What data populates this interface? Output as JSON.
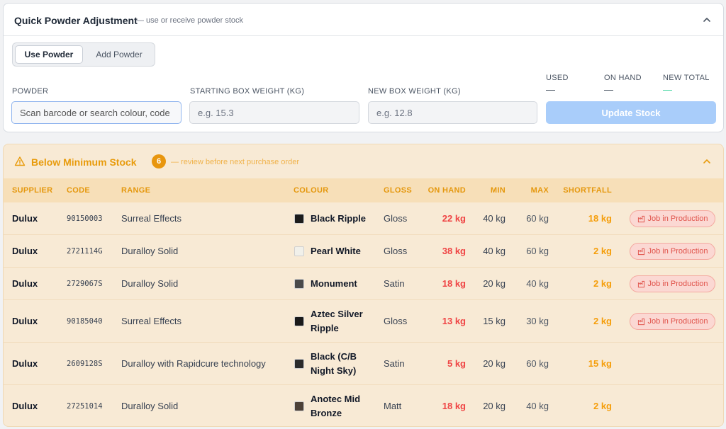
{
  "quick_adjust": {
    "title": "Quick Powder Adjustment",
    "subtitle": "— use or receive powder stock",
    "mode_tabs": [
      "Use Powder",
      "Add Powder"
    ],
    "active_tab": "Use Powder",
    "fields": {
      "powder_label": "POWDER",
      "powder_placeholder": "Scan barcode or search colour, code",
      "start_label": "STARTING BOX WEIGHT (KG)",
      "start_placeholder": "e.g. 15.3",
      "new_label": "NEW BOX WEIGHT (KG)",
      "new_placeholder": "e.g. 12.8"
    },
    "totals": {
      "used_label": "USED",
      "used_value": "—",
      "onhand_label": "ON HAND",
      "onhand_value": "—",
      "newtotal_label": "NEW TOTAL",
      "newtotal_value": "—"
    },
    "update_button": "Update Stock"
  },
  "below_min": {
    "title": "Below Minimum Stock",
    "count": "6",
    "subtitle": "— review before next purchase order",
    "columns": [
      "SUPPLIER",
      "CODE",
      "RANGE",
      "COLOUR",
      "GLOSS",
      "ON HAND",
      "MIN",
      "MAX",
      "SHORTFALL"
    ],
    "rows": [
      {
        "supplier": "Dulux",
        "code": "90150003",
        "range": "Surreal Effects",
        "colour": "Black Ripple",
        "swatch": "#1c1c1c",
        "gloss": "Gloss",
        "on_hand": "22 kg",
        "min": "40 kg",
        "max": "60 kg",
        "shortfall": "18 kg",
        "status": "Job in Production"
      },
      {
        "supplier": "Dulux",
        "code": "2721114G",
        "range": "Duralloy Solid",
        "colour": "Pearl White",
        "swatch": "#f1f0ea",
        "gloss": "Gloss",
        "on_hand": "38 kg",
        "min": "40 kg",
        "max": "60 kg",
        "shortfall": "2 kg",
        "status": "Job in Production"
      },
      {
        "supplier": "Dulux",
        "code": "2729067S",
        "range": "Duralloy Solid",
        "colour": "Monument",
        "swatch": "#4a4a4a",
        "gloss": "Satin",
        "on_hand": "18 kg",
        "min": "20 kg",
        "max": "40 kg",
        "shortfall": "2 kg",
        "status": "Job in Production"
      },
      {
        "supplier": "Dulux",
        "code": "90185040",
        "range": "Surreal Effects",
        "colour": "Aztec Silver Ripple",
        "swatch": "#1a1a1a",
        "gloss": "Gloss",
        "on_hand": "13 kg",
        "min": "15 kg",
        "max": "30 kg",
        "shortfall": "2 kg",
        "status": "Job in Production"
      },
      {
        "supplier": "Dulux",
        "code": "2609128S",
        "range": "Duralloy with Rapidcure technology",
        "colour": "Black (C/B Night Sky)",
        "swatch": "#2b2b2b",
        "gloss": "Satin",
        "on_hand": "5 kg",
        "min": "20 kg",
        "max": "60 kg",
        "shortfall": "15 kg",
        "status": ""
      },
      {
        "supplier": "Dulux",
        "code": "27251014",
        "range": "Duralloy Solid",
        "colour": "Anotec Mid Bronze",
        "swatch": "#4d4137",
        "gloss": "Matt",
        "on_hand": "18 kg",
        "min": "20 kg",
        "max": "40 kg",
        "shortfall": "2 kg",
        "status": ""
      }
    ]
  }
}
